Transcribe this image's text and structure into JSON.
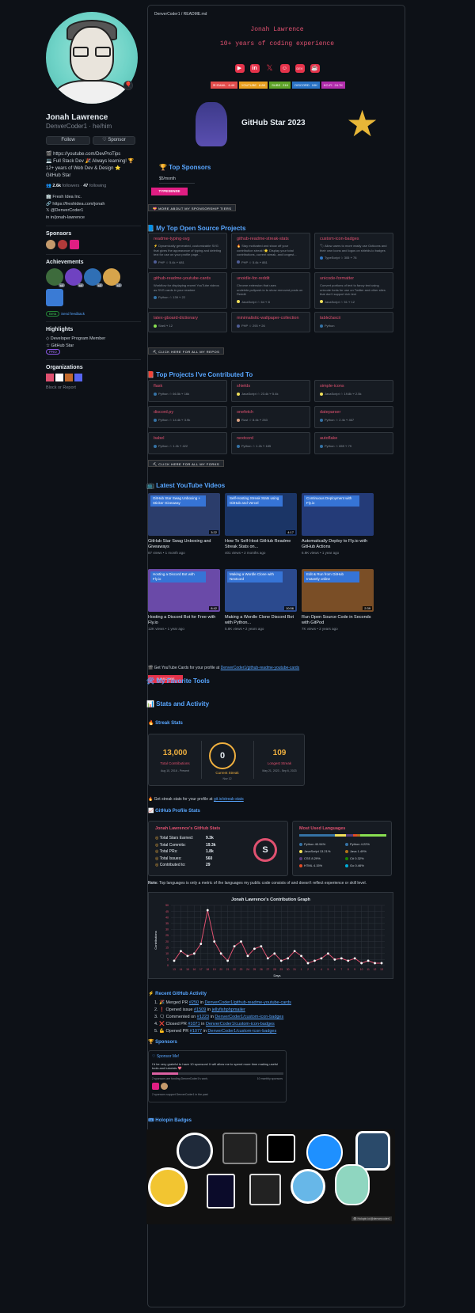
{
  "profile": {
    "name": "Jonah Lawrence",
    "login": "DenverCoder1 · he/him",
    "follow": "Follow",
    "sponsor": "♡ Sponsor",
    "bio": [
      "🎬 https://youtube.com/DevProTips",
      "💻 Full Stack Dev 🎉 Always learning! 🏆",
      "12+ years of Web Dev & Design ⭐",
      "GitHub Star"
    ],
    "followers": "2.6k",
    "followers_label": "followers",
    "following": "47",
    "following_label": "following",
    "company": "Fresh Idea Inc.",
    "website": "https://freshidea.com/jonah",
    "twitter": "@DenverCoder1",
    "linkedin": "in/jonah-lawrence",
    "sponsors_title": "Sponsors",
    "achievements_title": "Achievements",
    "beta": "Beta",
    "send_feedback": "Send feedback",
    "highlights_title": "Highlights",
    "highlights": [
      "Developer Program Member",
      "GitHub Star"
    ],
    "pro": "PRO",
    "orgs_title": "Organizations",
    "block": "Block or Report",
    "ach_counts": [
      "x4",
      "x4",
      "x3",
      "x3"
    ]
  },
  "readme": {
    "crumb": "DenverCoder1 / README.md",
    "typing": [
      "Jonah Lawrence",
      "10+ years of coding experience"
    ],
    "socials": [
      "youtube-icon",
      "linkedin-icon",
      "x-icon",
      "discord-icon",
      "dev-icon",
      "kofi-icon"
    ],
    "shields": [
      [
        "✉ EMAIL",
        "6.4K"
      ],
      [
        "YOUTUBE",
        "8.8K"
      ],
      [
        "SUBS",
        "21K"
      ],
      [
        "DISCORD",
        "10K"
      ],
      [
        "KO-FI",
        "24.7K"
      ]
    ],
    "github_star": "GitHub Star 2023"
  },
  "sponsors_section": {
    "title": "🏆 Top Sponsors",
    "tier": "$5/month",
    "typesense": "TYPESENSE",
    "more": "💝 MORE ABOUT MY SPONSORSHIP TIERS"
  },
  "projects": {
    "title": "📘 My Top Open Source Projects",
    "more": "⛏ CLICK HERE FOR ALL MY REPOS",
    "items": [
      {
        "name": "readme-typing-svg",
        "desc": "⚡ Dynamically generated, customizable SVG that gives the appearance of typing and deleting text for use on your profile page...",
        "lang": "PHP",
        "stars": "5.4k",
        "forks": "681",
        "color": "#4F5D95"
      },
      {
        "name": "github-readme-streak-stats",
        "desc": "🔥 Stay motivated and show off your contribution streak! 🌟 Display your total contributions, current streak, and longest...",
        "lang": "PHP",
        "stars": "5.4k",
        "forks": "881",
        "color": "#4F5D95"
      },
      {
        "name": "custom-icon-badges",
        "desc": "🏷 Allow users to more easily use Octicons and their own icons and logos on shields.io badges",
        "lang": "TypeScript",
        "stars": "305",
        "forks": "78",
        "color": "#3178c6"
      },
      {
        "name": "github-readme-youtube-cards",
        "desc": "Workflow for displaying recent YouTube videos as SVG cards in your readme",
        "lang": "Python",
        "stars": "139",
        "forks": "22",
        "color": "#3572A5"
      },
      {
        "name": "unoidle-for-reddit",
        "desc": "Chrome extension that uses undelete.pullpush.io to show removed posts on Reddit",
        "lang": "JavaScript",
        "stars": "64",
        "forks": "8",
        "color": "#f1e05a"
      },
      {
        "name": "unicode-formatter",
        "desc": "Convert portions of text to fancy text using unicode fonts for use on Twitter and other sites that don't support rich text",
        "lang": "JavaScript",
        "stars": "51",
        "forks": "12",
        "color": "#f1e05a"
      },
      {
        "name": "latex-gboard-dictionary",
        "desc": "",
        "lang": "Shell",
        "stars": "",
        "forks": "12",
        "color": "#89e051"
      },
      {
        "name": "minimalistic-wallpaper-collection",
        "desc": "",
        "lang": "PHP",
        "stars": "293",
        "forks": "26",
        "color": "#4F5D95"
      },
      {
        "name": "table2ascii",
        "desc": "",
        "lang": "Python",
        "stars": "",
        "forks": "",
        "color": "#3572A5"
      }
    ]
  },
  "contrib": {
    "title": "📕 Top Projects I've Contributed To",
    "more": "⛏ CLICK HERE FOR ALL MY FORKS",
    "items": [
      {
        "name": "flask",
        "lang": "Python",
        "stars": "66.5k",
        "forks": "16k",
        "color": "#3572A5"
      },
      {
        "name": "shields",
        "lang": "JavaScript",
        "stars": "23.4k",
        "forks": "5.4k",
        "color": "#f1e05a"
      },
      {
        "name": "simple-icons",
        "lang": "JavaScript",
        "stars": "19.8k",
        "forks": "2.5k",
        "color": "#f1e05a"
      },
      {
        "name": "discord.py",
        "lang": "Python",
        "stars": "14.4k",
        "forks": "3.9k",
        "color": "#3572A5"
      },
      {
        "name": "onefetch",
        "lang": "Rust",
        "stars": "8.4k",
        "forks": "263",
        "color": "#dea584"
      },
      {
        "name": "dateparser",
        "lang": "Python",
        "stars": "2.4k",
        "forks": "467",
        "color": "#3572A5"
      },
      {
        "name": "babel",
        "lang": "Python",
        "stars": "1.2k",
        "forks": "422",
        "color": "#3572A5"
      },
      {
        "name": "nextcord",
        "lang": "Python",
        "stars": "1.2k",
        "forks": "185",
        "color": "#3572A5"
      },
      {
        "name": "autoflake",
        "lang": "Python",
        "stars": "859",
        "forks": "79",
        "color": "#3572A5"
      }
    ]
  },
  "youtube": {
    "title": "📺 Latest YouTube Videos",
    "note": "🎬 Get YouTube Cards for your profile at ",
    "note_link": "DenverCoder1/github-readme-youtube-cards",
    "subscribe": "SUBSCRIBE",
    "videos": [
      {
        "title": "GitHub Star Swag Unboxing and Giveaways",
        "meta": "87 views • 1 month ago",
        "badge": "GitHub Star Swag Unboxing + Sticker Giveaway",
        "dur": "3:22",
        "bg": "#2b3d6b"
      },
      {
        "title": "How To Self-Host GitHub Readme Streak Stats on...",
        "meta": "401 views • 2 months ago",
        "badge": "Self-Hosting Streak Stats using GitHub and Vercel",
        "dur": "4:17",
        "bg": "#1b3566"
      },
      {
        "title": "Automatically Deploy to Fly.io with GitHub Actions",
        "meta": "6.9K views • 1 year ago",
        "badge": "Continuous Deployment with Fly.io",
        "dur": "",
        "bg": "#243b78"
      },
      {
        "title": "Hosting a Discord Bot for Free with Fly.io",
        "meta": "12K views • 1 year ago",
        "badge": "Hosting a Discord Bot with Fly.io",
        "dur": "8:42",
        "bg": "#6a4aa8"
      },
      {
        "title": "Making a Wordle Clone Discord Bot with Python...",
        "meta": "5.8K views • 2 years ago",
        "badge": "Making a Wordle Clone with Nextcord",
        "dur": "10:56",
        "bg": "#2b4a8e"
      },
      {
        "title": "Run Open Source Code in Seconds with GitPod",
        "meta": "7K views • 2 years ago",
        "badge": "Edit & Run from GitHub Instantly online",
        "dur": "2:39",
        "bg": "#7a4e26"
      }
    ]
  },
  "tools": {
    "title": "🛠 My Favorite Tools"
  },
  "stats": {
    "title": "📊 Stats and Activity",
    "streak_title": "🔥 Streak Stats",
    "total": "13,000",
    "total_label": "Total Contributions",
    "total_range": "Aug 10, 2016 - Present",
    "current": "0",
    "current_label": "Current Streak",
    "current_range": "Nov 12",
    "longest": "109",
    "longest_label": "Longest Streak",
    "longest_range": "May 21, 2023 - Sep 6, 2023",
    "streak_note": "🔥 Get streak stats for your profile at ",
    "streak_link": "git.io/streak-stats",
    "profile_title": "📈 GitHub Profile Stats",
    "card_title": "Jonah Lawrence's GitHub Stats",
    "rows": [
      [
        "Total Stars Earned:",
        "9.3k"
      ],
      [
        "Total Commits:",
        "19.3k"
      ],
      [
        "Total PRs:",
        "1.8k"
      ],
      [
        "Total Issues:",
        "560"
      ],
      [
        "Contributed to:",
        "29"
      ]
    ],
    "rank": "S",
    "lang_title": "Most Used Languages",
    "langs": [
      [
        "Python",
        "40.94%",
        "#3572A5"
      ],
      [
        "Python",
        "4.22%",
        "#3572A5"
      ],
      [
        "JavaScript",
        "13.21%",
        "#f1e05a"
      ],
      [
        "Java",
        "1.49%",
        "#b07219"
      ],
      [
        "CSS",
        "8.29%",
        "#563d7c"
      ],
      [
        "C#",
        "0.32%",
        "#178600"
      ],
      [
        "HTML",
        "4.15%",
        "#e34c26"
      ],
      [
        "Go",
        "0.46%",
        "#00ADD8"
      ]
    ],
    "note_bold": "Note:",
    "note": " Top languages is only a metric of the languages my public code consists of and doesn't reflect experience or skill level."
  },
  "chart_data": {
    "type": "line",
    "title": "Jonah Lawrence's Contribution Graph",
    "xlabel": "Days",
    "ylabel": "Contributions",
    "x": [
      "13",
      "14",
      "15",
      "16",
      "17",
      "18",
      "19",
      "20",
      "21",
      "22",
      "23",
      "24",
      "25",
      "26",
      "27",
      "28",
      "29",
      "30",
      "31",
      "1",
      "2",
      "3",
      "4",
      "5",
      "6",
      "7",
      "8",
      "9",
      "10",
      "11",
      "12",
      "13"
    ],
    "values": [
      4,
      12,
      8,
      10,
      18,
      46,
      20,
      10,
      4,
      16,
      20,
      8,
      14,
      16,
      6,
      10,
      4,
      6,
      12,
      8,
      2,
      4,
      6,
      10,
      5,
      6,
      4,
      6,
      2,
      4,
      2,
      2
    ],
    "ylim": [
      0,
      50
    ],
    "yticks": [
      "0",
      "5",
      "10",
      "15",
      "20",
      "25",
      "30",
      "35",
      "40",
      "45",
      "50"
    ]
  },
  "activity": {
    "title": "⚡ Recent GitHub Activity",
    "items": [
      [
        "🎉 Merged PR ",
        "#250",
        " in ",
        "DenverCoder1/github-readme-youtube-cards"
      ],
      [
        "❗ Opened issue ",
        "#1509",
        " in ",
        "jellyfishphpmailer"
      ],
      [
        "🗨 Commented on ",
        "#1223",
        " in ",
        "DenverCoder1/custom-icon-badges"
      ],
      [
        "❌ Closed PR ",
        "#1071",
        " in ",
        "DenverCoder1/custom-icon-badges"
      ],
      [
        "💪 Opened PR ",
        "#1077",
        " in ",
        "DenverCoder1/custom-icon-badges"
      ]
    ]
  },
  "sponsors_box": {
    "title": "🏆 Sponsors",
    "label": "♡ Sponsor Me!",
    "goal": "I'd be very grateful to have 10 sponsors! It will allow me to spend more time making useful tools and tutorials 💖",
    "count": "2 sponsors are funding DenverCoder1's work.",
    "target": "10 monthly sponsors",
    "past": "2 sponsors support DenverCoder1 in the past"
  },
  "holopin": {
    "title": "🎟 Holopin Badges",
    "footer": "👁 Holopin.io/@denvercoder1"
  }
}
